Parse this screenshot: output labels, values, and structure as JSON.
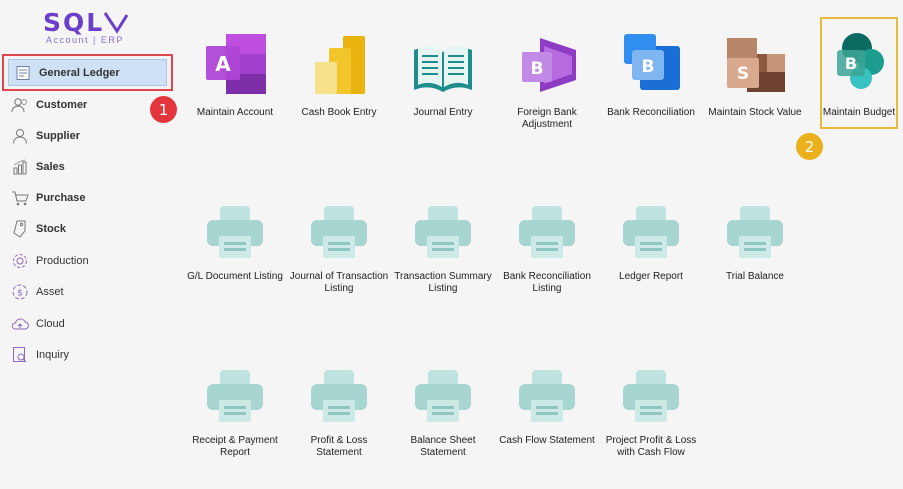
{
  "app": {
    "logo_text": "SQL",
    "logo_subtext": "Account | ERP"
  },
  "sidebar": {
    "items": [
      {
        "label": "General Ledger",
        "icon": "ledger-icon"
      },
      {
        "label": "Customer",
        "icon": "customer-icon"
      },
      {
        "label": "Supplier",
        "icon": "supplier-icon"
      },
      {
        "label": "Sales",
        "icon": "sales-chart-icon"
      },
      {
        "label": "Purchase",
        "icon": "cart-icon"
      },
      {
        "label": "Stock",
        "icon": "stock-tag-icon"
      },
      {
        "label": "Production",
        "icon": "gear-icon"
      },
      {
        "label": "Asset",
        "icon": "dollar-icon"
      },
      {
        "label": "Cloud",
        "icon": "cloud-icon"
      },
      {
        "label": "Inquiry",
        "icon": "document-search-icon"
      }
    ]
  },
  "annotations": {
    "step1": "1",
    "step2": "2"
  },
  "tiles_row1": [
    {
      "label": "Maintain Account",
      "icon": "access-app-icon",
      "letter": "A"
    },
    {
      "label": "Cash Book Entry",
      "icon": "powerbi-bars-icon"
    },
    {
      "label": "Journal Entry",
      "icon": "open-book-icon"
    },
    {
      "label": "Foreign Bank Adjustment",
      "icon": "forms-app-icon",
      "letter": "B"
    },
    {
      "label": "Bank Reconciliation",
      "icon": "blue-squares-app-icon",
      "letter": "B"
    },
    {
      "label": "Maintain Stock Value",
      "icon": "brown-squares-app-icon",
      "letter": "S"
    },
    {
      "label": "Maintain Budget",
      "icon": "sharepoint-app-icon",
      "letter": "B"
    }
  ],
  "tiles_row2": [
    {
      "label": "G/L Document Listing",
      "icon": "printer-icon"
    },
    {
      "label": "Journal of Transaction Listing",
      "icon": "printer-icon"
    },
    {
      "label": "Transaction Summary Listing",
      "icon": "printer-icon"
    },
    {
      "label": "Bank Reconciliation Listing",
      "icon": "printer-icon"
    },
    {
      "label": "Ledger Report",
      "icon": "printer-icon"
    },
    {
      "label": "Trial Balance",
      "icon": "printer-icon"
    }
  ],
  "tiles_row3": [
    {
      "label": "Receipt & Payment Report",
      "icon": "printer-icon"
    },
    {
      "label": "Profit & Loss Statement",
      "icon": "printer-icon"
    },
    {
      "label": "Balance Sheet Statement",
      "icon": "printer-icon"
    },
    {
      "label": "Cash Flow Statement",
      "icon": "printer-icon"
    },
    {
      "label": "Project Profit & Loss with Cash Flow",
      "icon": "printer-icon"
    }
  ]
}
